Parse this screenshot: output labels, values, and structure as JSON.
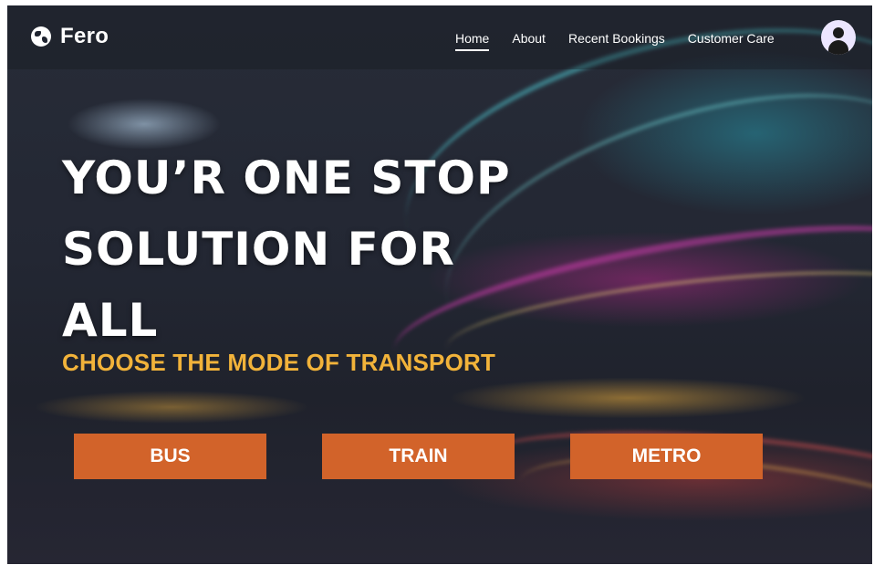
{
  "navbar": {
    "brand": "Fero",
    "brand_icon": "globe-icon",
    "links": [
      "Home",
      "About",
      "Recent Bookings",
      "Customer Care"
    ],
    "active_link": "Home",
    "avatar_icon": "user-avatar-icon"
  },
  "hero": {
    "title_lines": [
      "YOU’R ONE STOP",
      "SOLUTION FOR",
      "ALL"
    ],
    "subtitle": "CHOOSE THE MODE OF TRANSPORT"
  },
  "transport_modes": [
    "BUS",
    "TRAIN",
    "METRO"
  ],
  "colors": {
    "accent_orange": "#d2632a",
    "subtitle_yellow": "#f2b33a",
    "text_white": "#ffffff"
  }
}
